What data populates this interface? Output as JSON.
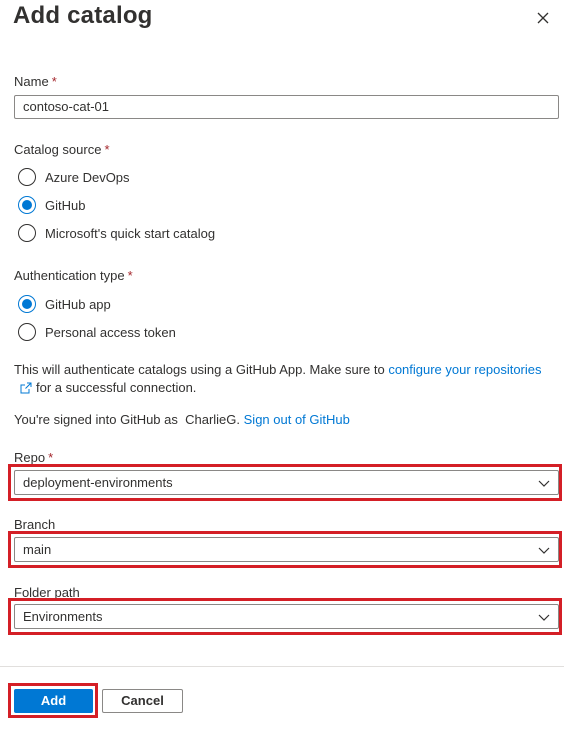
{
  "panel": {
    "title": "Add catalog",
    "close_icon": "close-icon"
  },
  "name_field": {
    "label": "Name",
    "required_mark": "*",
    "value": "contoso-cat-01"
  },
  "catalog_source": {
    "label": "Catalog source",
    "required_mark": "*",
    "options": [
      {
        "label": "Azure DevOps",
        "selected": false
      },
      {
        "label": "GitHub",
        "selected": true
      },
      {
        "label": "Microsoft's quick start catalog",
        "selected": false
      }
    ]
  },
  "auth_type": {
    "label": "Authentication type",
    "required_mark": "*",
    "options": [
      {
        "label": "GitHub app",
        "selected": true
      },
      {
        "label": "Personal access token",
        "selected": false
      }
    ]
  },
  "info": {
    "text_before_link": "This will authenticate catalogs using a GitHub App. Make sure to ",
    "link_text": "configure your repositories",
    "external_icon": "external-link-icon",
    "text_after_link": "for a successful connection."
  },
  "signed_in": {
    "text": "You're signed into GitHub as  CharlieG.",
    "signout_link": "Sign out of GitHub"
  },
  "repo": {
    "label": "Repo",
    "required_mark": "*",
    "value": "deployment-environments"
  },
  "branch": {
    "label": "Branch",
    "value": "main"
  },
  "folder_path": {
    "label": "Folder path",
    "value": "Environments"
  },
  "footer": {
    "add_label": "Add",
    "cancel_label": "Cancel"
  },
  "colors": {
    "accent": "#0078d4",
    "highlight": "#d41f26",
    "required": "#a4262c"
  }
}
